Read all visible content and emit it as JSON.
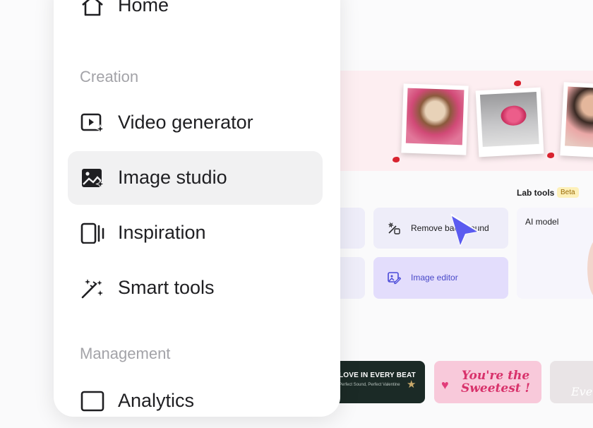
{
  "sidebar": {
    "items": [
      {
        "label": "Home",
        "icon": "home-icon"
      },
      {
        "label": "Video generator",
        "icon": "video-generator-icon"
      },
      {
        "label": "Image studio",
        "icon": "image-studio-icon",
        "active": true
      },
      {
        "label": "Inspiration",
        "icon": "inspiration-icon"
      },
      {
        "label": "Smart tools",
        "icon": "magic-wand-icon"
      },
      {
        "label": "Analytics",
        "icon": "analytics-icon"
      }
    ],
    "sections": {
      "creation": "Creation",
      "management": "Management"
    }
  },
  "lab_tools": {
    "title": "Lab tools",
    "badge": "Beta",
    "tools": [
      {
        "label": "Remove background",
        "icon": "remove-background-icon"
      },
      {
        "label": "Image editor",
        "icon": "image-editor-icon"
      },
      {
        "label": "AI model",
        "icon": ""
      }
    ]
  },
  "templates": {
    "dark_title": "LOVE IN EVERY BEAT",
    "dark_subtitle": "Perfect Sound, Perfect Valentine",
    "pink_title_line1": "You're the",
    "pink_title_line2": "Sweetest !",
    "grey_title": "Eve"
  },
  "colors": {
    "accent": "#5b5bf0",
    "active_tool_bg": "#e3ddfc",
    "tool_bg": "#eeedf9",
    "banner_bg": "#fdeef1",
    "beta_bg": "#fdf0b9"
  }
}
